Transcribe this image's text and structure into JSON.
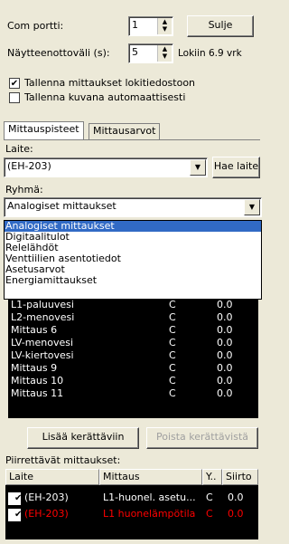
{
  "settings": {
    "com_port_label": "Com portti:",
    "com_port_value": "1",
    "close_button": "Sulje",
    "sample_interval_label": "Näytteenottoväli (s):",
    "sample_interval_value": "5",
    "log_days": "Lokiin 6.9 vrk",
    "save_logs_label": "Tallenna mittaukset lokitiedostoon",
    "save_logs_checked": true,
    "save_image_label": "Tallenna kuvana automaattisesti",
    "save_image_checked": false
  },
  "tabs": [
    {
      "label": "Mittauspisteet",
      "active": true
    },
    {
      "label": "Mittausarvot",
      "active": false
    }
  ],
  "device": {
    "label": "Laite:",
    "value": "(EH-203)",
    "find_button": "Hae laite"
  },
  "group": {
    "label": "Ryhmä:",
    "value": "Analogiset mittaukset",
    "options": [
      "Analogiset mittaukset",
      "Digitaalitulot",
      "Relelähdöt",
      "Venttiilien asentotiedot",
      "Asetusarvot",
      "Energiamittaukset"
    ],
    "selected_index": 0
  },
  "measurements": [
    {
      "name": "L1-paluuvesi",
      "type": "C",
      "value": "0.0"
    },
    {
      "name": "L2-menovesi",
      "type": "C",
      "value": "0.0"
    },
    {
      "name": "Mittaus 6",
      "type": "C",
      "value": "0.0"
    },
    {
      "name": "LV-menovesi",
      "type": "C",
      "value": "0.0"
    },
    {
      "name": "LV-kiertovesi",
      "type": "C",
      "value": "0.0"
    },
    {
      "name": "Mittaus 9",
      "type": "C",
      "value": "0.0"
    },
    {
      "name": "Mittaus 10",
      "type": "C",
      "value": "0.0"
    },
    {
      "name": "Mittaus 11",
      "type": "C",
      "value": "0.0"
    }
  ],
  "actions": {
    "add_button": "Lisää kerättäviin",
    "remove_button": "Poista kerättävistä"
  },
  "plotted": {
    "label": "Piirrettävät mittaukset:",
    "headers": [
      "Laite",
      "Mittaus",
      "Y..",
      "Siirto"
    ],
    "rows": [
      {
        "device": "(EH-203)",
        "measurement": "L1-huonel. asetu...",
        "unit": "C",
        "offset": "0.0",
        "color": "#ffffff",
        "checked": true
      },
      {
        "device": "(EH-203)",
        "measurement": "L1 huonelämpötila",
        "unit": "C",
        "offset": "0.0",
        "color": "#ff0000",
        "checked": true
      }
    ]
  }
}
